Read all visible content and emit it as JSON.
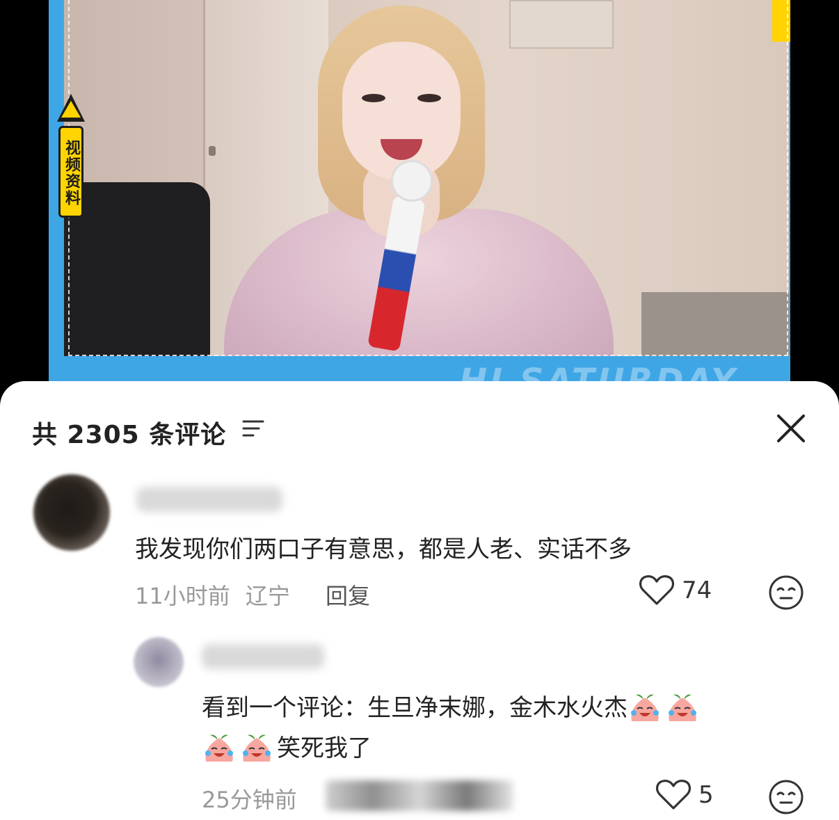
{
  "video": {
    "badge_text": "视频资料",
    "overlay_text": "HI SATURDAY"
  },
  "comments_header": {
    "title": "共 2305 条评论"
  },
  "comments": [
    {
      "text": "我发现你们两口子有意思，都是人老、实话不多",
      "time": "11小时前",
      "location": "辽宁",
      "reply_label": "回复",
      "likes": "74"
    },
    {
      "text_line1": "看到一个评论：生旦净末娜，金木水火杰",
      "text_line2_after_emoji": "笑死我了",
      "time": "25分钟前",
      "likes": "5"
    }
  ],
  "icons": {
    "sort": "filter-lines-icon",
    "close": "close-icon",
    "like": "heart-outline-icon",
    "face": "meh-face-icon",
    "emoji": "crying-laughing-peach-emoji"
  }
}
